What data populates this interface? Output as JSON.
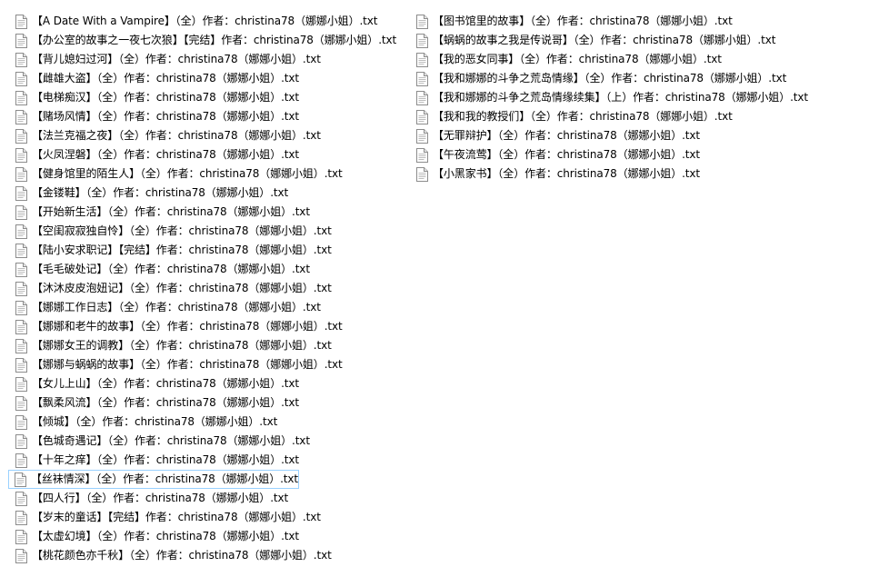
{
  "icon": "text-file-icon",
  "columns": [
    {
      "files": [
        "【A Date With a Vampire】（全）作者：christina78（娜娜小姐）.txt",
        "【办公室的故事之一夜七次狼】【完结】作者：christina78（娜娜小姐）.txt",
        "【背儿媳妇过河】（全）作者：christina78（娜娜小姐）.txt",
        "【雌雄大盗】（全）作者：christina78（娜娜小姐）.txt",
        "【电梯痴汉】（全）作者：christina78（娜娜小姐）.txt",
        "【赌场风情】（全）作者：christina78（娜娜小姐）.txt",
        "【法兰克福之夜】（全）作者：christina78（娜娜小姐）.txt",
        "【火凤涅磐】（全）作者：christina78（娜娜小姐）.txt",
        "【健身馆里的陌生人】（全）作者：christina78（娜娜小姐）.txt",
        "【金镂鞋】（全）作者：christina78（娜娜小姐）.txt",
        "【开始新生活】（全）作者：christina78（娜娜小姐）.txt",
        "【空闺寂寂独自怜】（全）作者：christina78（娜娜小姐）.txt",
        "【陆小安求职记】【完结】作者：christina78（娜娜小姐）.txt",
        "【毛毛破处记】（全）作者：christina78（娜娜小姐）.txt",
        "【沐沐皮皮泡妞记】（全）作者：christina78（娜娜小姐）.txt",
        "【娜娜工作日志】（全）作者：christina78（娜娜小姐）.txt",
        "【娜娜和老牛的故事】（全）作者：christina78（娜娜小姐）.txt",
        "【娜娜女王的调教】（全）作者：christina78（娜娜小姐）.txt",
        "【娜娜与蜗蜗的故事】（全）作者：christina78（娜娜小姐）.txt",
        "【女儿上山】（全）作者：christina78（娜娜小姐）.txt",
        "【飘柔风流】（全）作者：christina78（娜娜小姐）.txt",
        "【倾城】（全）作者：christina78（娜娜小姐）.txt",
        "【色城奇遇记】（全）作者：christina78（娜娜小姐）.txt",
        "【十年之痒】（全）作者：christina78（娜娜小姐）.txt",
        "【丝袜情深】（全）作者：christina78（娜娜小姐）.txt",
        "【四人行】（全）作者：christina78（娜娜小姐）.txt",
        "【岁末的童话】【完结】作者：christina78（娜娜小姐）.txt",
        "【太虚幻境】（全）作者：christina78（娜娜小姐）.txt",
        "【桃花颜色亦千秋】（全）作者：christina78（娜娜小姐）.txt"
      ]
    },
    {
      "files": [
        "【图书馆里的故事】（全）作者：christina78（娜娜小姐）.txt",
        "【蜗蜗的故事之我是传说哥】（全）作者：christina78（娜娜小姐）.txt",
        "【我的恶女同事】（全）作者：christina78（娜娜小姐）.txt",
        "【我和娜娜的斗争之荒岛情缘】（全）作者：christina78（娜娜小姐）.txt",
        "【我和娜娜的斗争之荒岛情缘续集】（上）作者：christina78（娜娜小姐）.txt",
        "【我和我的教授们】（全）作者：christina78（娜娜小姐）.txt",
        "【无罪辩护】（全）作者：christina78（娜娜小姐）.txt",
        "【午夜流莺】（全）作者：christina78（娜娜小姐）.txt",
        "【小黑家书】（全）作者：christina78（娜娜小姐）.txt"
      ]
    }
  ]
}
